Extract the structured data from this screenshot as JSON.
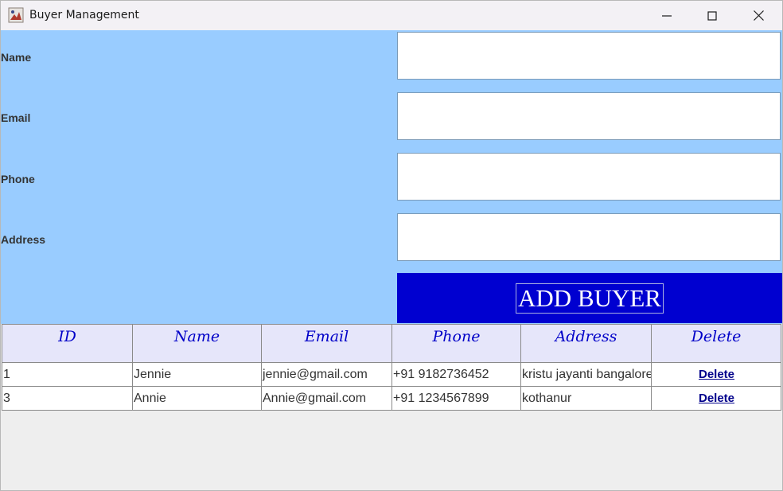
{
  "window": {
    "title": "Buyer Management",
    "icon": "java-app-icon",
    "controls": [
      "minimize-icon",
      "maximize-icon",
      "close-icon"
    ]
  },
  "form": {
    "fields": [
      {
        "label": "Name",
        "value": "",
        "placeholder": ""
      },
      {
        "label": "Email",
        "value": "",
        "placeholder": ""
      },
      {
        "label": "Phone",
        "value": "",
        "placeholder": ""
      },
      {
        "label": "Address",
        "value": "",
        "placeholder": ""
      }
    ],
    "add_button": "ADD BUYER"
  },
  "table": {
    "headers": [
      "ID",
      "Name",
      "Email",
      "Phone",
      "Address",
      "Delete"
    ],
    "rows": [
      {
        "id": "1",
        "name": "Jennie",
        "email": "jennie@gmail.com",
        "phone": "+91 9182736452",
        "address": "kristu jayanti bangalore",
        "action": "Delete"
      },
      {
        "id": "3",
        "name": "Annie",
        "email": "Annie@gmail.com",
        "phone": "+91 1234567899",
        "address": "kothanur",
        "action": "Delete"
      }
    ]
  },
  "colors": {
    "form_bg": "#99ccff",
    "button_bg": "#0000d0",
    "header_bg": "#e6e6fa",
    "header_text": "#0000c8",
    "link": "#00008b"
  }
}
